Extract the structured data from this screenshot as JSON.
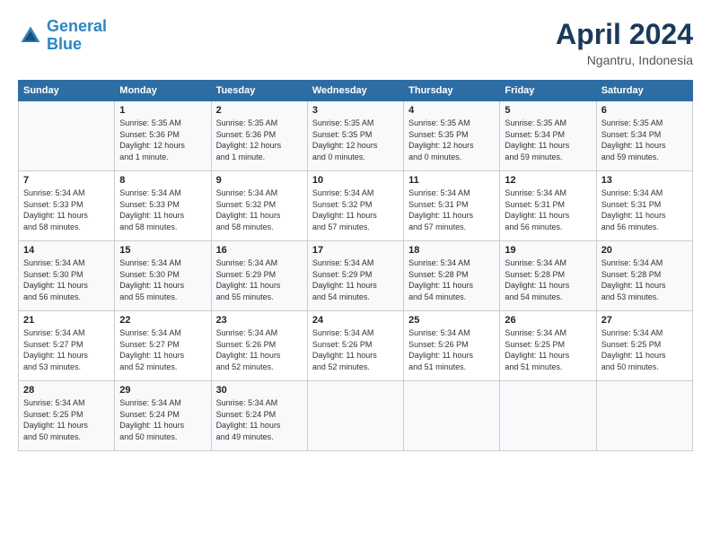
{
  "header": {
    "logo_line1": "General",
    "logo_line2": "Blue",
    "month": "April 2024",
    "location": "Ngantru, Indonesia"
  },
  "weekdays": [
    "Sunday",
    "Monday",
    "Tuesday",
    "Wednesday",
    "Thursday",
    "Friday",
    "Saturday"
  ],
  "weeks": [
    [
      {
        "day": "",
        "info": ""
      },
      {
        "day": "1",
        "info": "Sunrise: 5:35 AM\nSunset: 5:36 PM\nDaylight: 12 hours\nand 1 minute."
      },
      {
        "day": "2",
        "info": "Sunrise: 5:35 AM\nSunset: 5:36 PM\nDaylight: 12 hours\nand 1 minute."
      },
      {
        "day": "3",
        "info": "Sunrise: 5:35 AM\nSunset: 5:35 PM\nDaylight: 12 hours\nand 0 minutes."
      },
      {
        "day": "4",
        "info": "Sunrise: 5:35 AM\nSunset: 5:35 PM\nDaylight: 12 hours\nand 0 minutes."
      },
      {
        "day": "5",
        "info": "Sunrise: 5:35 AM\nSunset: 5:34 PM\nDaylight: 11 hours\nand 59 minutes."
      },
      {
        "day": "6",
        "info": "Sunrise: 5:35 AM\nSunset: 5:34 PM\nDaylight: 11 hours\nand 59 minutes."
      }
    ],
    [
      {
        "day": "7",
        "info": "Sunrise: 5:34 AM\nSunset: 5:33 PM\nDaylight: 11 hours\nand 58 minutes."
      },
      {
        "day": "8",
        "info": "Sunrise: 5:34 AM\nSunset: 5:33 PM\nDaylight: 11 hours\nand 58 minutes."
      },
      {
        "day": "9",
        "info": "Sunrise: 5:34 AM\nSunset: 5:32 PM\nDaylight: 11 hours\nand 58 minutes."
      },
      {
        "day": "10",
        "info": "Sunrise: 5:34 AM\nSunset: 5:32 PM\nDaylight: 11 hours\nand 57 minutes."
      },
      {
        "day": "11",
        "info": "Sunrise: 5:34 AM\nSunset: 5:31 PM\nDaylight: 11 hours\nand 57 minutes."
      },
      {
        "day": "12",
        "info": "Sunrise: 5:34 AM\nSunset: 5:31 PM\nDaylight: 11 hours\nand 56 minutes."
      },
      {
        "day": "13",
        "info": "Sunrise: 5:34 AM\nSunset: 5:31 PM\nDaylight: 11 hours\nand 56 minutes."
      }
    ],
    [
      {
        "day": "14",
        "info": "Sunrise: 5:34 AM\nSunset: 5:30 PM\nDaylight: 11 hours\nand 56 minutes."
      },
      {
        "day": "15",
        "info": "Sunrise: 5:34 AM\nSunset: 5:30 PM\nDaylight: 11 hours\nand 55 minutes."
      },
      {
        "day": "16",
        "info": "Sunrise: 5:34 AM\nSunset: 5:29 PM\nDaylight: 11 hours\nand 55 minutes."
      },
      {
        "day": "17",
        "info": "Sunrise: 5:34 AM\nSunset: 5:29 PM\nDaylight: 11 hours\nand 54 minutes."
      },
      {
        "day": "18",
        "info": "Sunrise: 5:34 AM\nSunset: 5:28 PM\nDaylight: 11 hours\nand 54 minutes."
      },
      {
        "day": "19",
        "info": "Sunrise: 5:34 AM\nSunset: 5:28 PM\nDaylight: 11 hours\nand 54 minutes."
      },
      {
        "day": "20",
        "info": "Sunrise: 5:34 AM\nSunset: 5:28 PM\nDaylight: 11 hours\nand 53 minutes."
      }
    ],
    [
      {
        "day": "21",
        "info": "Sunrise: 5:34 AM\nSunset: 5:27 PM\nDaylight: 11 hours\nand 53 minutes."
      },
      {
        "day": "22",
        "info": "Sunrise: 5:34 AM\nSunset: 5:27 PM\nDaylight: 11 hours\nand 52 minutes."
      },
      {
        "day": "23",
        "info": "Sunrise: 5:34 AM\nSunset: 5:26 PM\nDaylight: 11 hours\nand 52 minutes."
      },
      {
        "day": "24",
        "info": "Sunrise: 5:34 AM\nSunset: 5:26 PM\nDaylight: 11 hours\nand 52 minutes."
      },
      {
        "day": "25",
        "info": "Sunrise: 5:34 AM\nSunset: 5:26 PM\nDaylight: 11 hours\nand 51 minutes."
      },
      {
        "day": "26",
        "info": "Sunrise: 5:34 AM\nSunset: 5:25 PM\nDaylight: 11 hours\nand 51 minutes."
      },
      {
        "day": "27",
        "info": "Sunrise: 5:34 AM\nSunset: 5:25 PM\nDaylight: 11 hours\nand 50 minutes."
      }
    ],
    [
      {
        "day": "28",
        "info": "Sunrise: 5:34 AM\nSunset: 5:25 PM\nDaylight: 11 hours\nand 50 minutes."
      },
      {
        "day": "29",
        "info": "Sunrise: 5:34 AM\nSunset: 5:24 PM\nDaylight: 11 hours\nand 50 minutes."
      },
      {
        "day": "30",
        "info": "Sunrise: 5:34 AM\nSunset: 5:24 PM\nDaylight: 11 hours\nand 49 minutes."
      },
      {
        "day": "",
        "info": ""
      },
      {
        "day": "",
        "info": ""
      },
      {
        "day": "",
        "info": ""
      },
      {
        "day": "",
        "info": ""
      }
    ]
  ]
}
